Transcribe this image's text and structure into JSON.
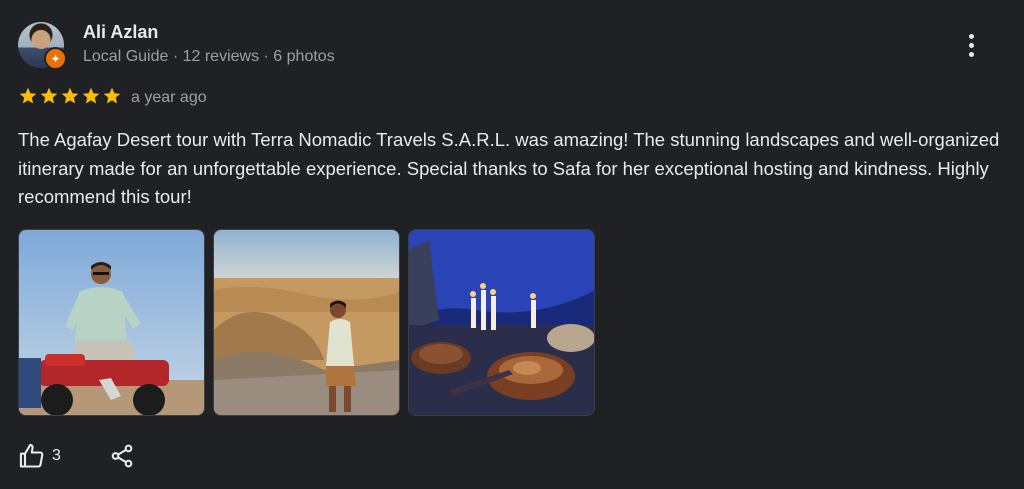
{
  "reviewer": {
    "name": "Ali Azlan",
    "meta": "Local Guide · 12 reviews · 6 photos"
  },
  "rating": {
    "stars": 5,
    "max": 5,
    "time": "a year ago"
  },
  "review_text": "The Agafay Desert tour with Terra Nomadic Travels S.A.R.L. was amazing! The stunning landscapes and well-organized itinerary made for an unforgettable experience. Special thanks to Safa for her exceptional hosting and kindness. Highly recommend this tour!",
  "photos": [
    {
      "icon": "photo-quad-bike"
    },
    {
      "icon": "photo-desert-landscape"
    },
    {
      "icon": "photo-candlelit-dinner"
    }
  ],
  "actions": {
    "like_count": "3"
  },
  "colors": {
    "background": "#202124",
    "star": "#fbbc04",
    "guide_badge": "#e8710a",
    "text_primary": "#e8eaed",
    "text_secondary": "#9aa0a6"
  }
}
